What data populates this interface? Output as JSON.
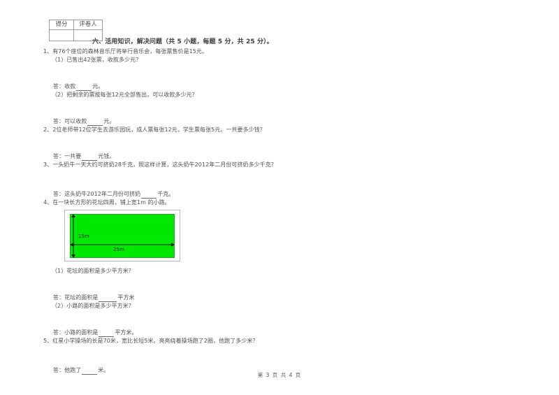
{
  "score_table": {
    "headers": [
      "得分",
      "评卷人"
    ]
  },
  "section": {
    "title": "六、活用知识，解决问题（共 5 小题，每题 5 分，共 25 分）。"
  },
  "questions": [
    {
      "number": "1、",
      "stem": "1、有76个座位的森林音乐厅将举行音乐会，每张票售价是15元。",
      "sub1": "（1）已售出42张票，收款多少元？",
      "answer1_pre": "答：收款",
      "answer1_post": "元。",
      "sub2": "（2）把剩余的票按每张12元全部售出，可以收款多少元？",
      "answer2_pre": "答：可以收款",
      "answer2_post": "元。"
    },
    {
      "number": "2、",
      "stem": "2、2位老师带12位学生去游乐园玩，成人票每张12元，学生票每张5元。一共要多少钱？",
      "answer_pre": "答：一共要",
      "answer_post": "元钱。"
    },
    {
      "number": "3、",
      "stem": "3、一头奶牛一天大约可挤奶28千克，照这样计算，这头奶牛2012年二月份可挤奶多少千克？",
      "answer_pre": "答：这头奶牛2012年二月份可挤奶",
      "answer_post": "千克。"
    },
    {
      "number": "4、",
      "stem": "4、在一块长方形的花坛四周，铺上宽1m 的小路。",
      "sub1": "（1）花坛的面积是多少平方米？",
      "answer1_pre": "答：花坛的面积是",
      "answer1_post": "平方米",
      "sub2": "（2）小路的面积是多少平方米？",
      "answer2_pre": "答：小路的面积是",
      "answer2_post": "平方米。"
    },
    {
      "number": "5、",
      "stem": "5、红星小学操场的长是70米，宽比长短5米。亮亮绕着操场跑了2圈，他跑了多少米？",
      "answer_pre": "答：他跑了",
      "answer_post": "米。"
    }
  ],
  "figure": {
    "width_label": "25m",
    "height_label": "15m",
    "fill_color": "#00e800",
    "border_color": "#2fa02f"
  },
  "footer": {
    "text": "第 3 页 共 4 页"
  }
}
